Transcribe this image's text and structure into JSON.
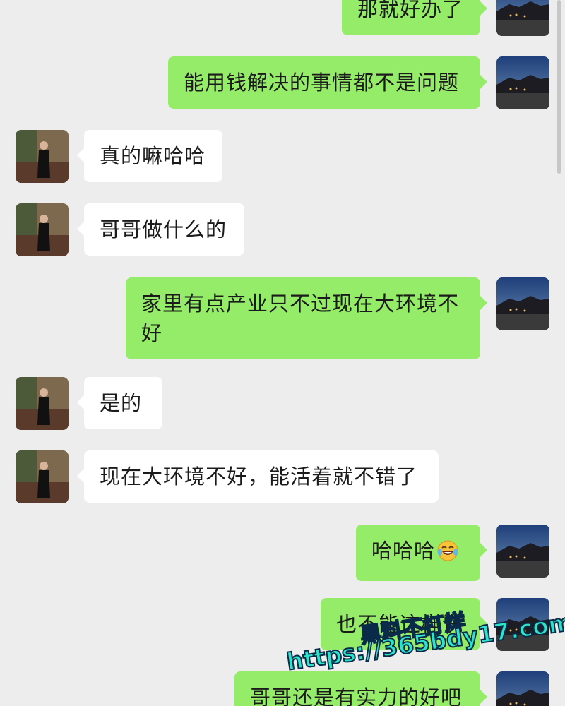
{
  "chat": {
    "messages": [
      {
        "side": "right",
        "text": "那就好办了"
      },
      {
        "side": "right",
        "text": "能用钱解决的事情都不是问题"
      },
      {
        "side": "left",
        "text": "真的嘛哈哈"
      },
      {
        "side": "left",
        "text": "哥哥做什么的"
      },
      {
        "side": "right",
        "text": "家里有点产业只不过现在大环境不好"
      },
      {
        "side": "left",
        "text": "是的"
      },
      {
        "side": "left",
        "text": "现在大环境不好，能活着就不错了"
      },
      {
        "side": "right",
        "text": "哈哈哈",
        "emoji": "tears-of-joy-emoji"
      },
      {
        "side": "right",
        "text": "也不能这样说"
      },
      {
        "side": "right",
        "text": "哥哥还是有实力的好吧"
      }
    ]
  },
  "watermark": {
    "line1": "黑料不打烊",
    "line2": "https://365bdy17.com"
  },
  "colors": {
    "background": "#ededed",
    "bubble_self": "#95ec69",
    "bubble_other": "#ffffff",
    "watermark": "#2de3c8"
  }
}
